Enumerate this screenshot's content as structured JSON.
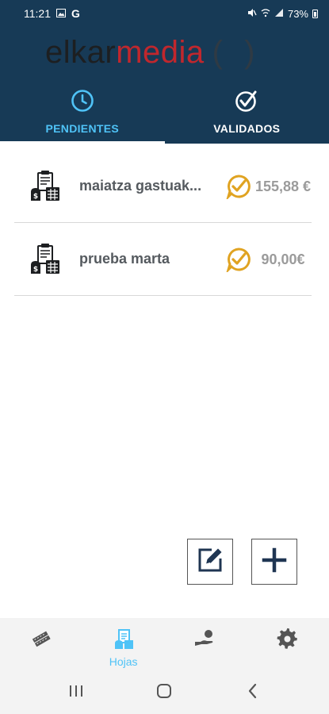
{
  "status_bar": {
    "time": "11:21",
    "carrier_glyph": "G",
    "battery": "73%",
    "icons": [
      "image-icon",
      "mute-icon",
      "wifi-icon",
      "signal-icon",
      "battery-icon"
    ]
  },
  "header": {
    "logo": {
      "part1": "elkar",
      "part2": "media",
      "part3": "( )"
    },
    "tabs": [
      {
        "label": "PENDIENTES",
        "icon": "clock-icon",
        "active": true
      },
      {
        "label": "VALIDADOS",
        "icon": "check-circle-icon",
        "active": false
      }
    ]
  },
  "list": {
    "items": [
      {
        "name": "maiatza gastuak...",
        "amount": "155,88 €",
        "status_icon": "pending-badge-icon"
      },
      {
        "name": "prueba marta",
        "amount": "90,00€",
        "status_icon": "pending-badge-icon"
      }
    ]
  },
  "actions": {
    "edit_icon": "edit-icon",
    "add_icon": "plus-icon"
  },
  "bottom_nav": {
    "items": [
      {
        "icon": "tickets-icon",
        "label": ""
      },
      {
        "icon": "sheets-icon",
        "label": "Hojas",
        "active": true
      },
      {
        "icon": "hand-coin-icon",
        "label": ""
      },
      {
        "icon": "gear-icon",
        "label": ""
      }
    ]
  },
  "colors": {
    "header_bg": "#173a56",
    "accent": "#4fc3f7",
    "logo_red": "#c1272d",
    "status_gold": "#e0a321",
    "amount_gray": "#9b9b9b"
  }
}
